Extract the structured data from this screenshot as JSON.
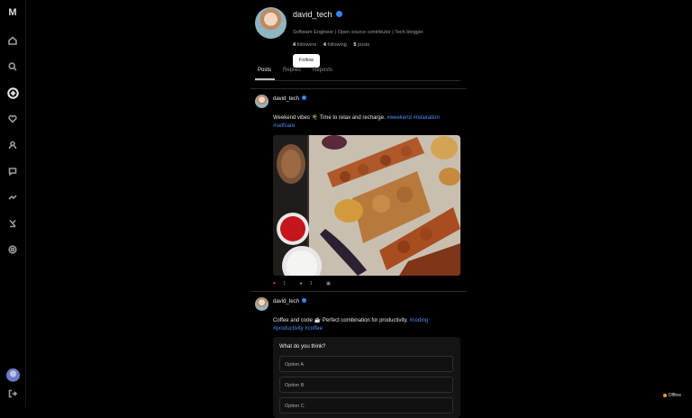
{
  "sidebar": {
    "logo": "M",
    "icons": [
      "home-icon",
      "search-icon",
      "create-icon",
      "heart-icon",
      "profile-icon",
      "messages-icon",
      "trending-icon",
      "grok-icon",
      "settings-icon"
    ],
    "bottom_icon": "logout-icon"
  },
  "profile": {
    "username": "david_tech",
    "bio": "Software Engineer | Open source contributor | Tech blogger",
    "followers_count": "4",
    "followers_label": "followers",
    "following_count": "4",
    "following_label": "following",
    "posts_count": "5",
    "posts_label": "posts",
    "follow_label": "Follow"
  },
  "tabs": [
    {
      "label": "Posts",
      "active": true
    },
    {
      "label": "Replies",
      "active": false
    },
    {
      "label": "Reposts",
      "active": false
    }
  ],
  "posts": [
    {
      "username": "david_tech",
      "text": "Weekend vibes 🌴 Time to relax and recharge.",
      "hashtags": [
        "#weekend",
        "#relaxation",
        "#selfcare"
      ],
      "likes": "1",
      "comments": "1",
      "image": "grilled-food-photo"
    },
    {
      "username": "david_tech",
      "text": "Coffee and code ☕ Perfect combination for productivity.",
      "hashtags": [
        "#coding",
        "#productivity",
        "#coffee"
      ],
      "poll": {
        "question": "What do you think?",
        "options": [
          "Option A",
          "Option B",
          "Option C"
        ]
      }
    }
  ],
  "status": {
    "label": "Offline",
    "color": "#f59e0b"
  }
}
